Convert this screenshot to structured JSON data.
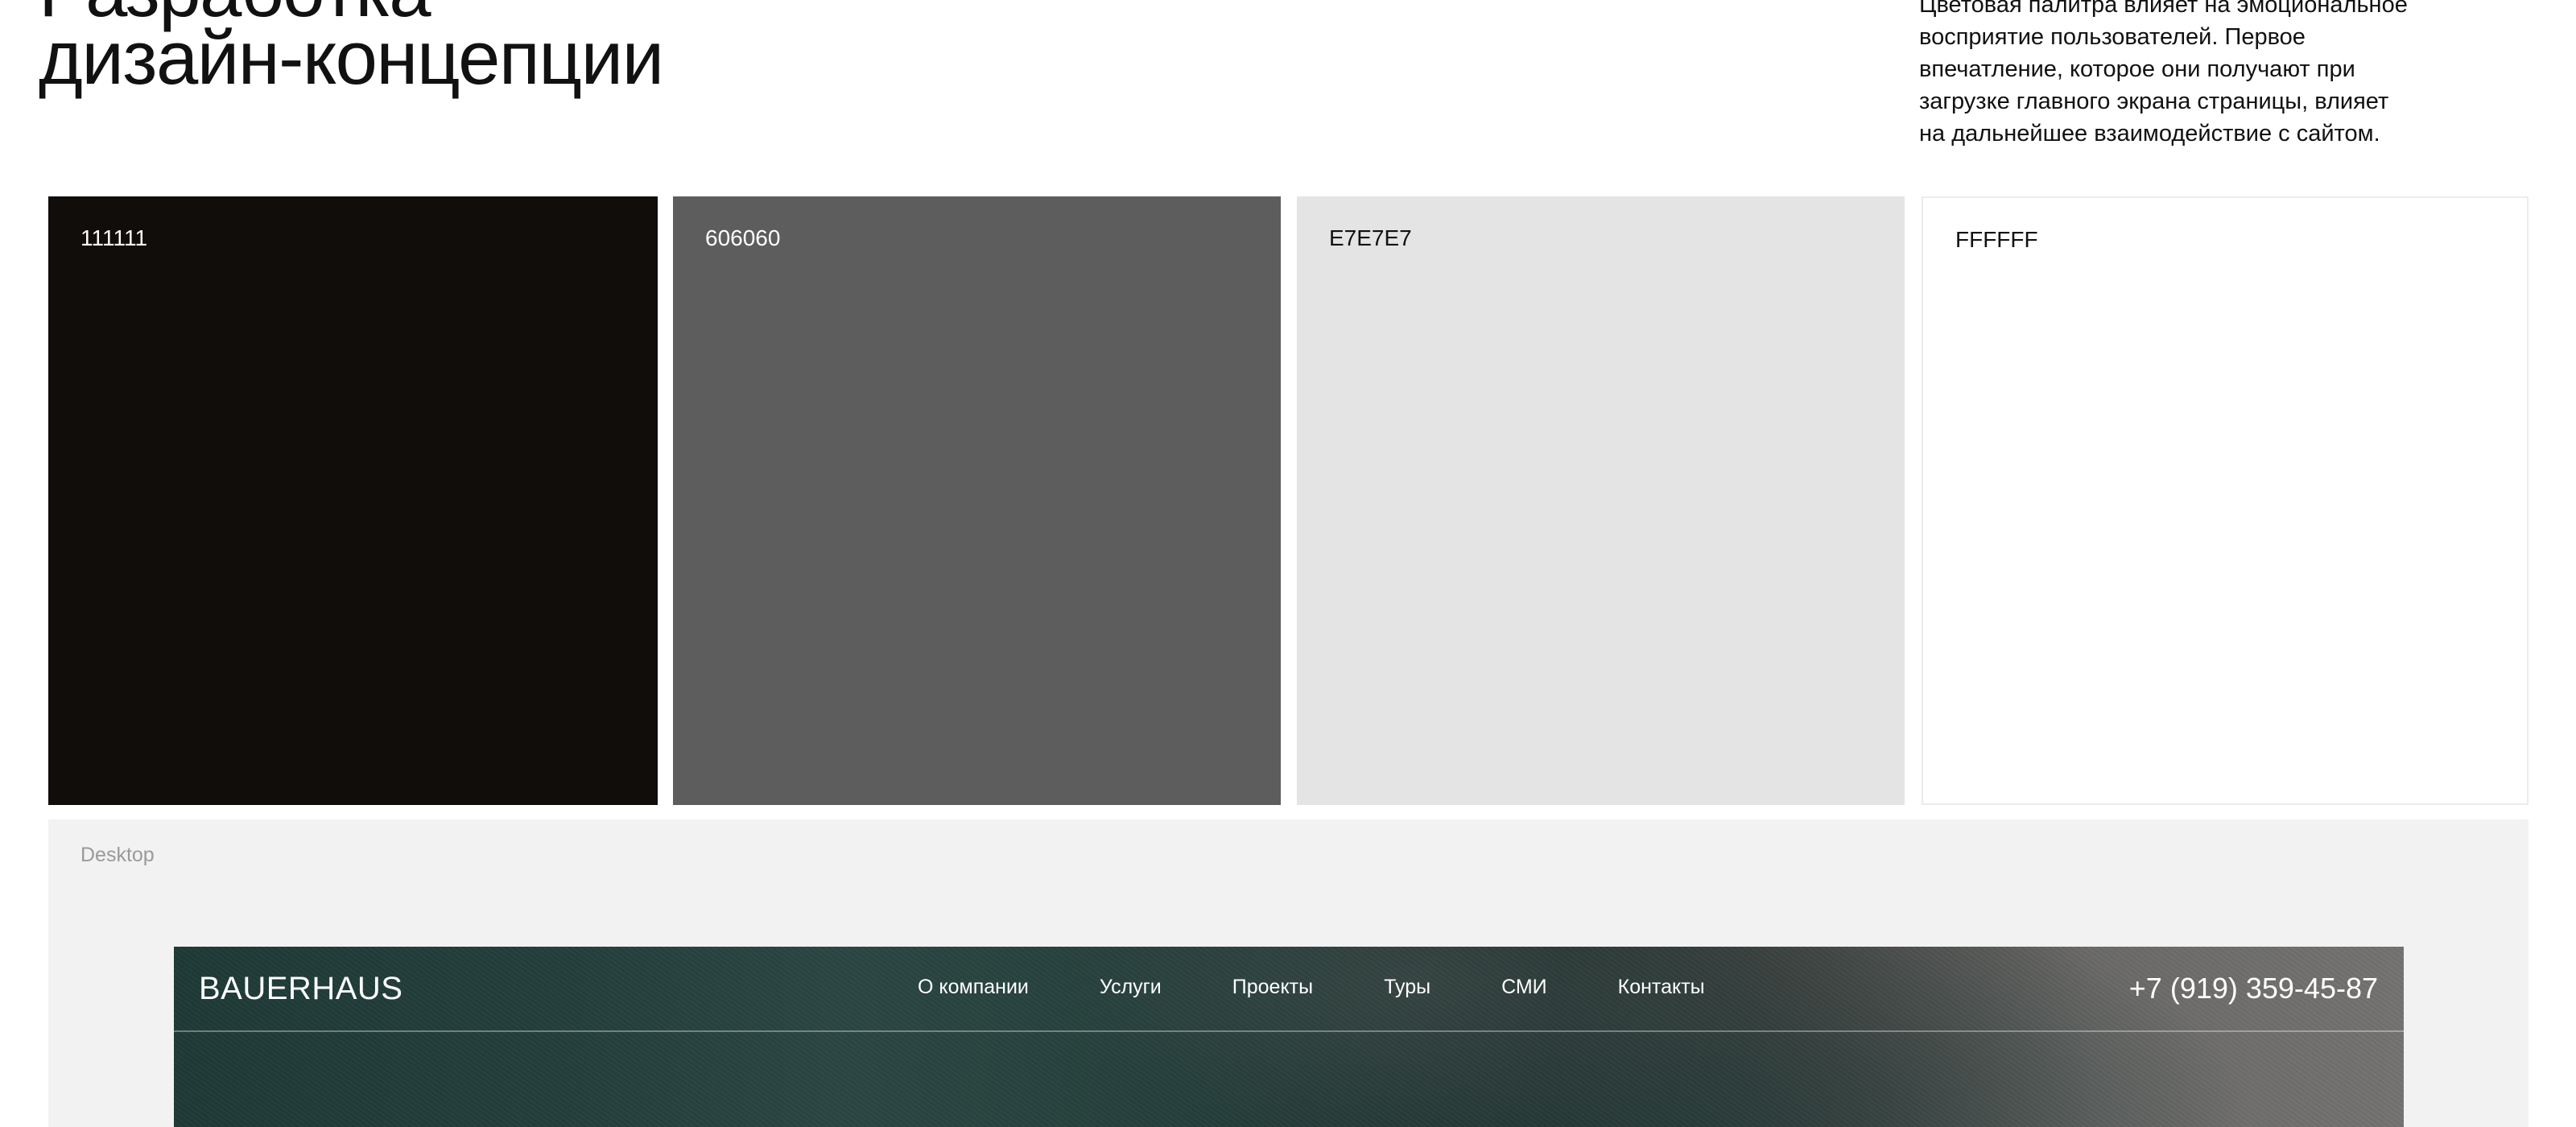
{
  "header": {
    "title_lines": [
      "Разработка",
      "дизайн-концепции"
    ],
    "description_lines": [
      "Цветовая палитра влияет на эмоциональное",
      "восприятие пользователей. Первое",
      "впечатление, которое они получают при",
      "загрузке главного экрана страницы, влияет",
      "на дальнейшее взаимодействие с сайтом."
    ]
  },
  "palette": [
    {
      "code": "111111",
      "color": "#100d0a",
      "text_color": "#ffffff"
    },
    {
      "code": "606060",
      "color": "#5d5d5d",
      "text_color": "#ffffff"
    },
    {
      "code": "E7E7E7",
      "color": "#e4e4e4",
      "text_color": "#111111"
    },
    {
      "code": "FFFFFF",
      "color": "#ffffff",
      "text_color": "#111111"
    }
  ],
  "preview": {
    "label": "Desktop",
    "site": {
      "logo": "BAUERHAUS",
      "menu": [
        "О компании",
        "Услуги",
        "Проекты",
        "Туры",
        "СМИ",
        "Контакты"
      ],
      "phone": "+7 (919) 359-45-87"
    }
  }
}
